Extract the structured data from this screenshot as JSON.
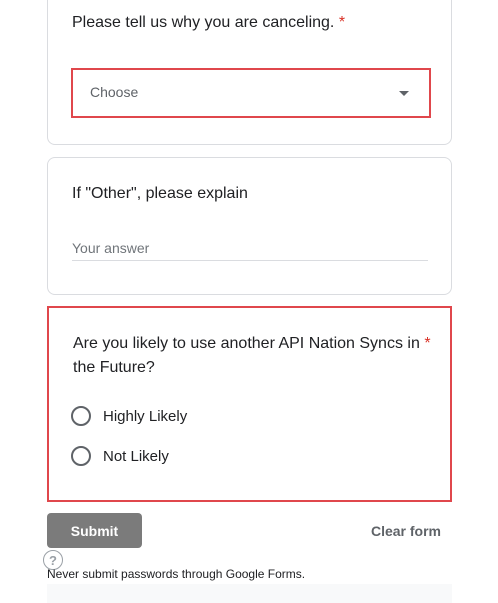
{
  "question1": {
    "title": "Please tell us why you are canceling.",
    "required_mark": "*",
    "dropdown": {
      "value": "Choose"
    }
  },
  "question2": {
    "title": "If \"Other\", please explain",
    "placeholder": "Your answer"
  },
  "question3": {
    "title_line1": "Are you likely to use another API Nation Syncs in",
    "title_line2": "the Future?",
    "required_mark": "*",
    "options": [
      "Highly Likely",
      "Not Likely"
    ]
  },
  "actions": {
    "submit_label": "Submit",
    "clear_label": "Clear form"
  },
  "footer": {
    "help_icon": "?",
    "note": "Never submit passwords through Google Forms."
  },
  "colors": {
    "highlight_border": "#e0474c",
    "required": "#d93025",
    "submit_bg": "#7b7b7b"
  }
}
